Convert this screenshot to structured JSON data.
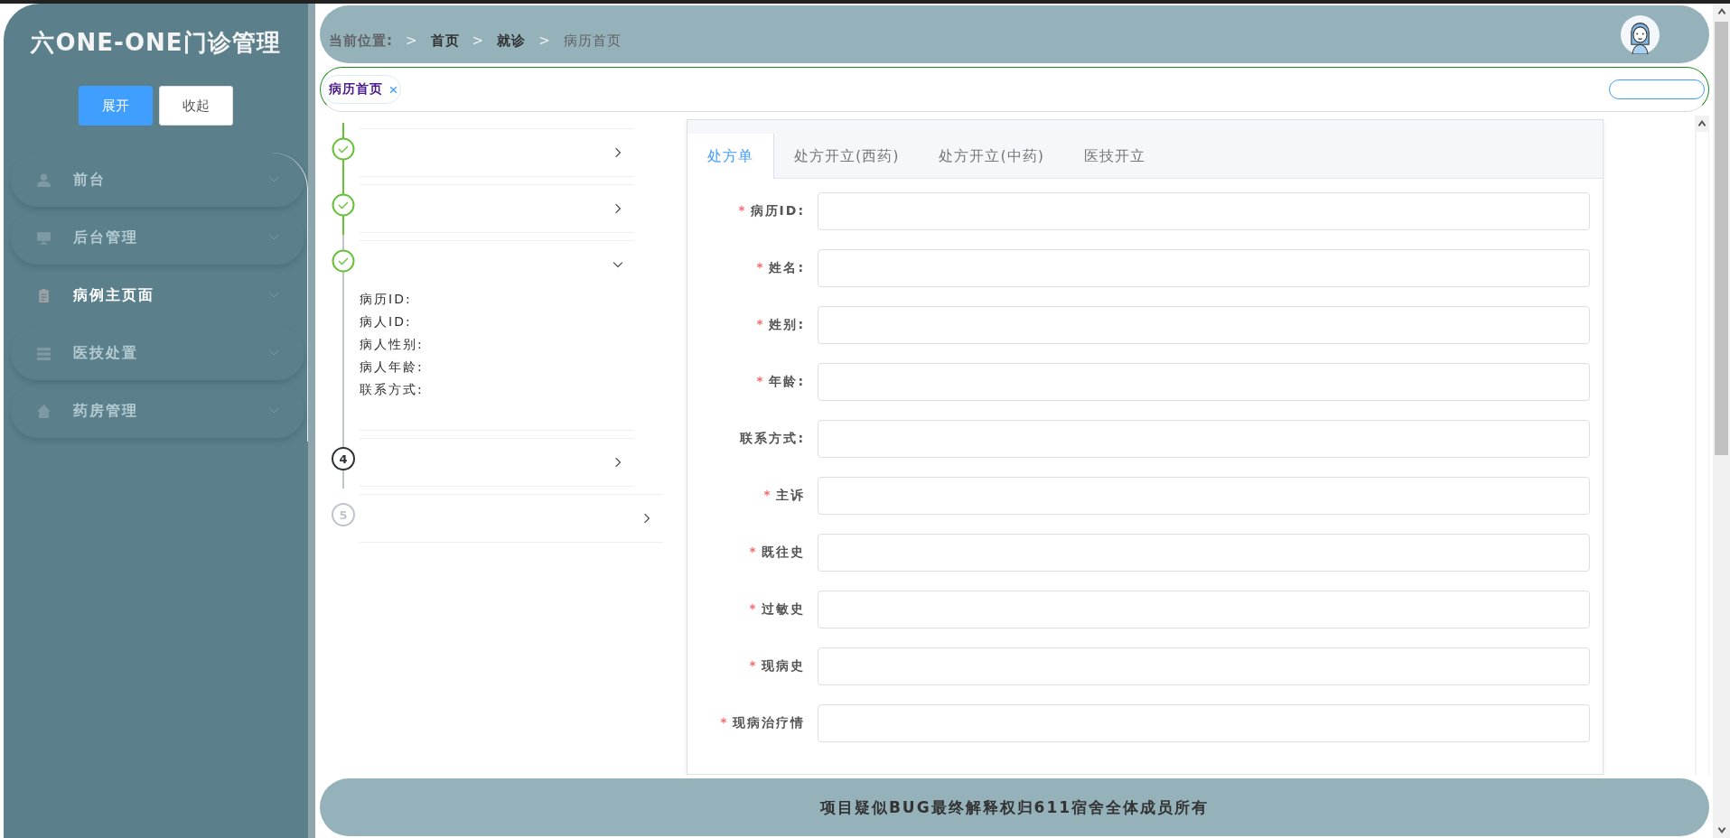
{
  "sidebar": {
    "title": "六ONE-ONE门诊管理",
    "buttons": [
      {
        "label": "展开",
        "kind": "primary"
      },
      {
        "label": "收起",
        "kind": "default"
      }
    ],
    "items": [
      {
        "label": "前台",
        "selected": false
      },
      {
        "label": "后台管理",
        "selected": false
      },
      {
        "label": "病例主页面",
        "selected": true
      },
      {
        "label": "医技处置",
        "selected": false
      },
      {
        "label": "药房管理",
        "selected": false
      }
    ]
  },
  "header": {
    "breadcrumb_label": "当前位置:",
    "breadcrumb": [
      {
        "label": "首页",
        "current": false
      },
      {
        "label": "就诊",
        "current": false
      },
      {
        "label": "病历首页",
        "current": true
      }
    ],
    "separator": ">"
  },
  "page_tabs": [
    {
      "label": "病历首页",
      "selected": true
    }
  ],
  "steps": [
    {
      "kind": "finish",
      "expanded": false
    },
    {
      "kind": "finish",
      "expanded": false
    },
    {
      "kind": "finish",
      "expanded": true,
      "details": [
        "病历ID:",
        "病人ID:",
        "病人性别:",
        "病人年龄:",
        "联系方式:"
      ]
    },
    {
      "kind": "process",
      "number": "4",
      "expanded": false
    },
    {
      "kind": "wait",
      "number": "5",
      "expanded": false
    }
  ],
  "form_tabs": [
    {
      "label": "处方单",
      "selected": true
    },
    {
      "label": "处方开立(西药)",
      "selected": false
    },
    {
      "label": "处方开立(中药)",
      "selected": false
    },
    {
      "label": "医技开立",
      "selected": false
    }
  ],
  "form_fields": [
    {
      "label": "病历ID:",
      "required": true
    },
    {
      "label": "姓名:",
      "required": true
    },
    {
      "label": "姓别:",
      "required": true
    },
    {
      "label": "年龄:",
      "required": true
    },
    {
      "label": "联系方式:",
      "required": false
    },
    {
      "label": "主诉",
      "required": true
    },
    {
      "label": "既往史",
      "required": true
    },
    {
      "label": "过敏史",
      "required": true
    },
    {
      "label": "现病史",
      "required": true
    },
    {
      "label": "现病治疗情",
      "required": true
    }
  ],
  "footer": {
    "text": "项目疑似BUG最终解释权归611宿舍全体成员所有"
  }
}
